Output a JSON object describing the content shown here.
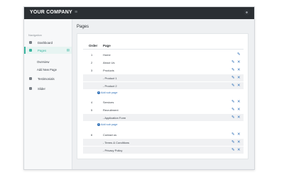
{
  "header": {
    "brand": "YOUR COMPANY",
    "menu_icon": "hamburger-icon",
    "settings_icon": "gear-icon"
  },
  "sidebar": {
    "heading": "Navigation",
    "items": [
      {
        "label": "Dashboard",
        "icon": "dashboard-icon"
      },
      {
        "label": "Pages",
        "icon": "pages-icon",
        "active": true
      },
      {
        "label": "Testimonials",
        "icon": "testimonials-icon"
      },
      {
        "label": "Slider",
        "icon": "slider-icon"
      }
    ],
    "sub_items": [
      "Overview",
      "Add New Page"
    ]
  },
  "main": {
    "title": "Pages",
    "columns": [
      "Order",
      "Page"
    ],
    "rows": [
      {
        "order": "1",
        "page": "Home",
        "actions": "edit"
      },
      {
        "order": "2",
        "page": "About Us",
        "actions": "edit-delete"
      },
      {
        "order": "3",
        "page": "Products",
        "actions": "edit-delete"
      },
      {
        "order": "",
        "page": "- Product 1",
        "actions": "edit-delete",
        "sub": true
      },
      {
        "order": "",
        "page": "- Product 2",
        "actions": "edit-delete",
        "sub": true
      },
      {
        "add_sub": "Add sub page"
      },
      {
        "order": "4",
        "page": "Services",
        "actions": "edit-delete"
      },
      {
        "order": "5",
        "page": "Recruitment",
        "actions": "edit-delete"
      },
      {
        "order": "",
        "page": "- Application Form",
        "actions": "edit-delete",
        "sub": true
      },
      {
        "add_sub": "Add sub page"
      },
      {
        "order": "6",
        "page": "Contact us",
        "actions": "edit-delete"
      },
      {
        "order": "",
        "page": "- Terms & Conditions",
        "actions": "edit-delete",
        "sub": true
      },
      {
        "order": "",
        "page": "- Privacy Policy",
        "actions": "edit-delete",
        "sub": true
      }
    ]
  },
  "colors": {
    "topbar": "#2b2f33",
    "accent": "#3bb6a1",
    "link": "#2e6fb7"
  }
}
